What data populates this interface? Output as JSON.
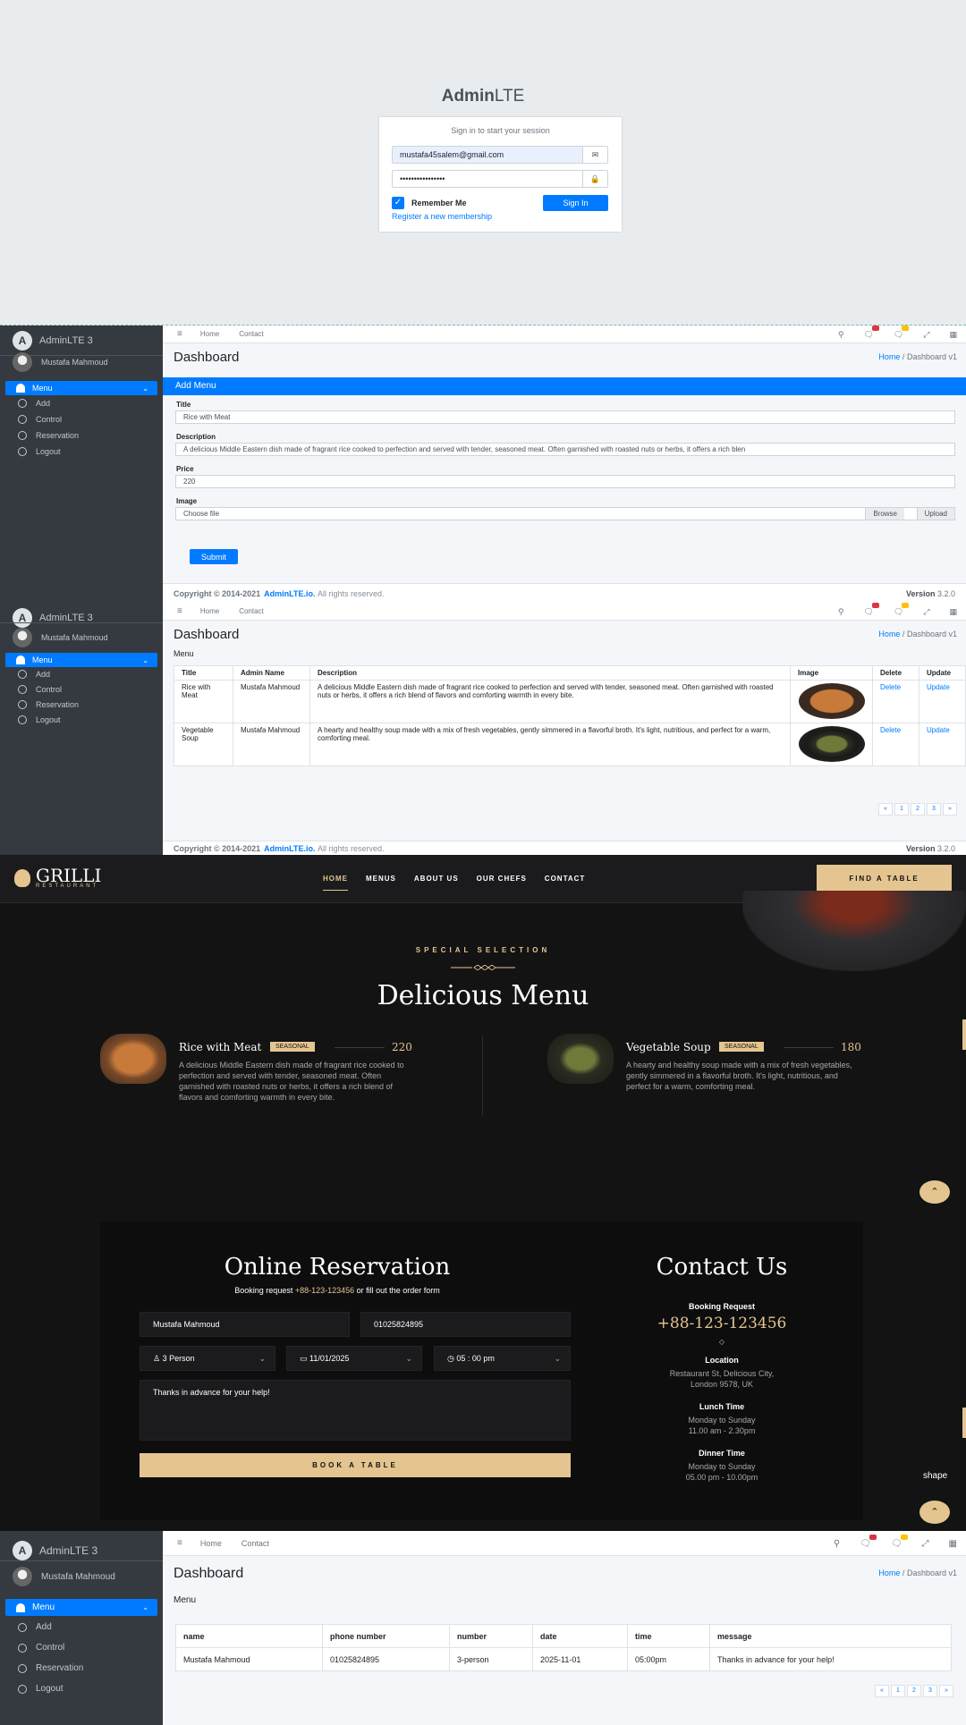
{
  "login": {
    "logo_bold": "Admin",
    "logo_light": "LTE",
    "message": "Sign in to start your session",
    "email": "mustafa45salem@gmail.com",
    "password": "••••••••••••••••",
    "remember": "Remember Me",
    "signin": "Sign In",
    "register": "Register a new membership",
    "remember_checked": true
  },
  "admin": {
    "brand": "AdminLTE 3",
    "brand_letter": "A",
    "user": "Mustafa Mahmoud",
    "menu": [
      {
        "label": "Menu",
        "active": true
      },
      {
        "label": "Add"
      },
      {
        "label": "Control"
      },
      {
        "label": "Reservation"
      },
      {
        "label": "Logout"
      }
    ],
    "topnav": {
      "home": "Home",
      "contact": "Contact",
      "hamburger": "≡"
    },
    "page_title": "Dashboard",
    "breadcrumb": {
      "home": "Home",
      "sep": "/",
      "current": "Dashboard v1"
    },
    "footer": {
      "copyright": "Copyright © 2014-2021",
      "brand": "AdminLTE.io.",
      "rights": "All rights reserved.",
      "version_label": "Version",
      "version": "3.2.0"
    },
    "icons": [
      "search-icon",
      "comments-icon",
      "bell-icon",
      "expand-icon",
      "grid-icon"
    ]
  },
  "add_menu": {
    "card_title": "Add Menu",
    "title_label": "Title",
    "title_value": "Rice with Meat",
    "description_label": "Description",
    "description_value": "A delicious Middle Eastern dish made of fragrant rice cooked to perfection and served with tender, seasoned meat. Often garnished with roasted nuts or herbs, it offers a rich blen",
    "price_label": "Price",
    "price_value": "220",
    "image_label": "Image",
    "file_placeholder": "Choose file",
    "browse": "Browse",
    "upload": "Upload",
    "submit": "Submit"
  },
  "menu_table": {
    "sub_title": "Menu",
    "headers": [
      "Title",
      "Admin Name",
      "Description",
      "Image",
      "Delete",
      "Update"
    ],
    "rows": [
      {
        "title": "Rice with Meat",
        "admin": "Mustafa Mahmoud",
        "description": "A delicious Middle Eastern dish made of fragrant rice cooked to perfection and served with tender, seasoned meat. Often garnished with roasted nuts or herbs, it offers a rich blend of flavors and comforting warmth in every bite.",
        "delete": "Delete",
        "update": "Update"
      },
      {
        "title": "Vegetable Soup",
        "admin": "Mustafa Mahmoud",
        "description": "A hearty and healthy soup made with a mix of fresh vegetables, gently simmered in a flavorful broth. It's light, nutritious, and perfect for a warm, comforting meal.",
        "delete": "Delete",
        "update": "Update"
      }
    ],
    "pager": [
      "«",
      "1",
      "2",
      "3",
      "»"
    ]
  },
  "grilli": {
    "logo": "GRILLI",
    "logo_sub": "RESTAURANT",
    "nav": [
      "HOME",
      "MENUS",
      "ABOUT US",
      "OUR CHEFS",
      "CONTACT"
    ],
    "find_table": "FIND A TABLE",
    "eyebrow": "SPECIAL SELECTION",
    "title": "Delicious Menu",
    "items": [
      {
        "name": "Rice with Meat",
        "badge": "SEASONAL",
        "price": "220",
        "desc": "A delicious Middle Eastern dish made of fragrant rice cooked to perfection and served with tender, seasoned meat. Often garnished with roasted nuts or herbs, it offers a rich blend of flavors and comforting warmth in every bite."
      },
      {
        "name": "Vegetable Soup",
        "badge": "SEASONAL",
        "price": "180",
        "desc": "A hearty and healthy soup made with a mix of fresh vegetables, gently simmered in a flavorful broth. It's light, nutritious, and perfect for a warm, comforting meal."
      }
    ],
    "reservation": {
      "title": "Online Reservation",
      "sub_pre": "Booking request",
      "sub_phone": "+88-123-123456",
      "sub_post": "or fill out the order form",
      "name": "Mustafa Mahmoud",
      "phone": "01025824895",
      "persons": "3 Person",
      "date": "11/01/2025",
      "time": "05 : 00 pm",
      "message": "Thanks in advance for your help!",
      "book": "BOOK A TABLE"
    },
    "contact": {
      "title": "Contact Us",
      "booking_label": "Booking Request",
      "booking_phone": "+88-123-123456",
      "location_label": "Location",
      "location_1": "Restaurant St, Delicious City,",
      "location_2": "London 9578, UK",
      "lunch_label": "Lunch Time",
      "lunch_days": "Monday to Sunday",
      "lunch_hours": "11.00 am - 2.30pm",
      "dinner_label": "Dinner Time",
      "dinner_days": "Monday to Sunday",
      "dinner_hours": "05.00 pm - 10.00pm"
    },
    "shape_alt": "shape",
    "up_arrow": "⌃",
    "colors": {
      "gold": "#e4c590",
      "dark": "#131314"
    }
  },
  "reservations_table": {
    "sub_title": "Menu",
    "headers": [
      "name",
      "phone number",
      "number",
      "date",
      "time",
      "message"
    ],
    "rows": [
      {
        "name": "Mustafa Mahmoud",
        "phone": "01025824895",
        "number": "3-person",
        "date": "2025-11-01",
        "time": "05:00pm",
        "message": "Thanks in advance for your help!"
      }
    ],
    "pager": [
      "«",
      "1",
      "2",
      "3",
      "»"
    ]
  }
}
